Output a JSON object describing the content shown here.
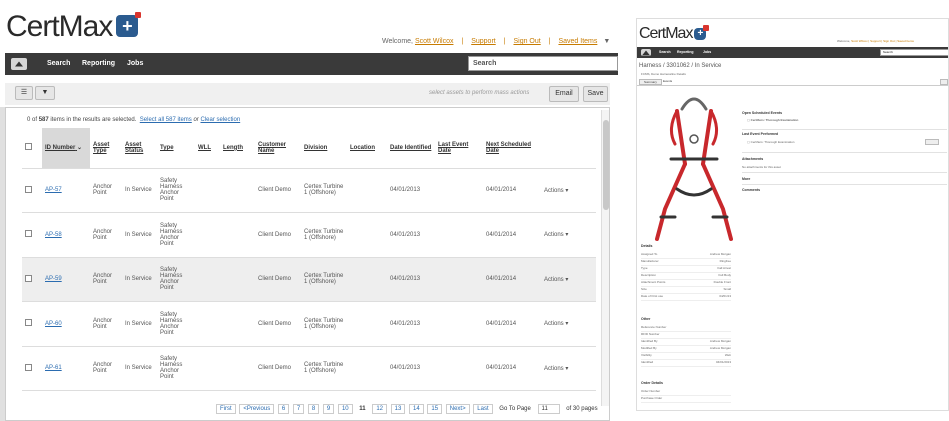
{
  "app": {
    "brand": "CertMax",
    "brand_accent": "#2b5b8f"
  },
  "header": {
    "welcome_prefix": "Welcome,",
    "user_name": "Scott Wilcox",
    "links": [
      "Support",
      "Sign Out",
      "Saved Items"
    ]
  },
  "nav": {
    "items": [
      "Search",
      "Reporting",
      "Jobs"
    ],
    "search_placeholder": "Search"
  },
  "toolbar": {
    "hint": "select assets to perform mass actions",
    "email_label": "Email",
    "save_label": "Save"
  },
  "selection": {
    "prefix": "0 of",
    "count": "587",
    "middle": "items in the results are selected.",
    "select_all": "Select all 587 items",
    "or": "or",
    "clear": "Clear selection"
  },
  "table": {
    "columns": [
      "ID Number",
      "Asset Type",
      "Asset Status",
      "Type",
      "WLL",
      "Length",
      "Customer Name",
      "Division",
      "Location",
      "Date Identified",
      "Last Event Date",
      "Next Scheduled Date",
      ""
    ],
    "rows": [
      {
        "id": "AP-57",
        "asset_type": "Anchor Point",
        "status": "In Service",
        "type": "Safety Harness Anchor Point",
        "wll": "",
        "length": "",
        "customer": "Client Demo",
        "division": "Certex Turbine 1 (Offshore)",
        "location": "",
        "date_identified": "04/01/2013",
        "last_event": "",
        "next_scheduled": "04/01/2014",
        "action": "Actions"
      },
      {
        "id": "AP-58",
        "asset_type": "Anchor Point",
        "status": "In Service",
        "type": "Safety Harness Anchor Point",
        "wll": "",
        "length": "",
        "customer": "Client Demo",
        "division": "Certex Turbine 1 (Offshore)",
        "location": "",
        "date_identified": "04/01/2013",
        "last_event": "",
        "next_scheduled": "04/01/2014",
        "action": "Actions"
      },
      {
        "id": "AP-59",
        "asset_type": "Anchor Point",
        "status": "In Service",
        "type": "Safety Harness Anchor Point",
        "wll": "",
        "length": "",
        "customer": "Client Demo",
        "division": "Certex Turbine 1 (Offshore)",
        "location": "",
        "date_identified": "04/01/2013",
        "last_event": "",
        "next_scheduled": "04/01/2014",
        "action": "Actions"
      },
      {
        "id": "AP-60",
        "asset_type": "Anchor Point",
        "status": "In Service",
        "type": "Safety Harness Anchor Point",
        "wll": "",
        "length": "",
        "customer": "Client Demo",
        "division": "Certex Turbine 1 (Offshore)",
        "location": "",
        "date_identified": "04/01/2013",
        "last_event": "",
        "next_scheduled": "04/01/2014",
        "action": "Actions"
      },
      {
        "id": "AP-61",
        "asset_type": "Anchor Point",
        "status": "In Service",
        "type": "Safety Harness Anchor Point",
        "wll": "",
        "length": "",
        "customer": "Client Demo",
        "division": "Certex Turbine 1 (Offshore)",
        "location": "",
        "date_identified": "04/01/2013",
        "last_event": "",
        "next_scheduled": "04/01/2014",
        "action": "Actions"
      }
    ]
  },
  "pager": {
    "first": "First",
    "prev": "<Previous",
    "pages": [
      "6",
      "7",
      "8",
      "9",
      "10",
      "11",
      "12",
      "13",
      "14",
      "15"
    ],
    "current": "11",
    "next": "Next>",
    "last": "Last",
    "goto_label": "Go To Page",
    "goto_value": "11",
    "of_label": "of 30 pages"
  },
  "detail": {
    "brand": "CertMax",
    "breadcrumb": "Harness / 3301062 / In Service",
    "sub": "FCMS, Demo Harnessline Details",
    "tabs": [
      "Summary",
      "Events"
    ],
    "sections": {
      "open_scheduled": "Open Scheduled Events",
      "scheduled_item": "Certifiers: Thorough Examination",
      "last_event": "Last Event Performed",
      "attachments": "Attachments",
      "attachments_note": "No attachments for this asset",
      "more": "More",
      "comments": "Comments",
      "details": "Details",
      "other": "Other",
      "order_details": "Order Details"
    },
    "details_kv": [
      [
        "Assigned To",
        "Andrew Morgan"
      ],
      [
        "Manufacturer",
        "Ringfree"
      ],
      [
        "Type",
        "Fall Arrest"
      ],
      [
        "Description",
        "Full Body"
      ],
      [
        "Attachment Points",
        "Double Front"
      ],
      [
        "Size",
        "Small"
      ],
      [
        "Date of First use",
        "04/01/13"
      ]
    ],
    "other_kv": [
      [
        "Reference Number",
        ""
      ],
      [
        "RFID Number",
        ""
      ],
      [
        "Identified By",
        "Andrew Morgan"
      ],
      [
        "Modified By",
        "Andrew Morgan"
      ],
      [
        "Visibility",
        "Web"
      ],
      [
        "Identified",
        "04/01/2013"
      ]
    ],
    "order_kv": [
      [
        "Order Number",
        ""
      ],
      [
        "Purchase Order",
        ""
      ]
    ]
  }
}
